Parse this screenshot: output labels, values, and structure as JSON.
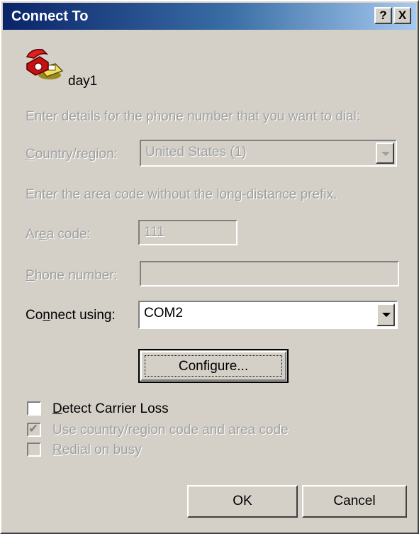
{
  "window": {
    "title": "Connect To",
    "help_button": "?",
    "close_button": "X"
  },
  "connection": {
    "name": "day1",
    "icon": "phone-connection-icon"
  },
  "instructions": {
    "dial": "Enter details for the phone number that you want to dial:",
    "area": "Enter the area code without the long-distance prefix."
  },
  "fields": {
    "country_label": "Country/region:",
    "country_value": "United States (1)",
    "area_label": "Area code:",
    "area_value": "111",
    "phone_label": "Phone number:",
    "phone_value": "",
    "connect_label": "Connect using:",
    "connect_value": "COM2"
  },
  "buttons": {
    "configure": "Configure...",
    "ok": "OK",
    "cancel": "Cancel"
  },
  "checkboxes": {
    "detect_carrier": {
      "label": "Detect Carrier Loss",
      "checked": false,
      "enabled": true
    },
    "use_country_code": {
      "label": "Use country/region code and area code",
      "checked": true,
      "enabled": false
    },
    "redial_busy": {
      "label": "Redial on busy",
      "checked": false,
      "enabled": false
    }
  },
  "colors": {
    "face": "#d4d0c8",
    "title_start": "#0a246a",
    "title_end": "#a6caf0",
    "disabled_text": "#a0a0a0"
  }
}
